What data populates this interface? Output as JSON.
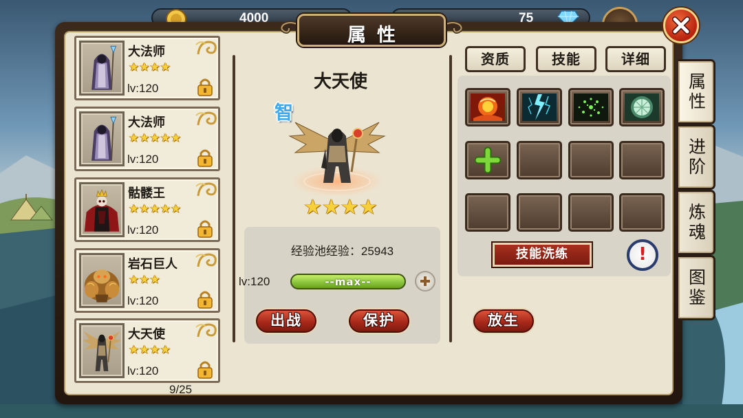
{
  "top_bar": {
    "gold": {
      "icon": "gold-coin-icon",
      "value": "4000"
    },
    "gems": {
      "icon": "diamond-icon",
      "value": "75"
    }
  },
  "window": {
    "title": "属性",
    "close_icon": "close-icon"
  },
  "hero_list": {
    "items": [
      {
        "name": "大法师",
        "stars": 4,
        "level": "lv:120",
        "portrait": "archmage-portrait",
        "lock_icon": "lock-icon"
      },
      {
        "name": "大法师",
        "stars": 5,
        "level": "lv:120",
        "portrait": "archmage-portrait",
        "lock_icon": "lock-icon"
      },
      {
        "name": "骷髅王",
        "stars": 5,
        "level": "lv:120",
        "portrait": "skeleton-king-portrait",
        "lock_icon": "lock-icon"
      },
      {
        "name": "岩石巨人",
        "stars": 3,
        "level": "lv:120",
        "portrait": "rock-giant-portrait",
        "lock_icon": "lock-icon"
      },
      {
        "name": "大天使",
        "stars": 4,
        "level": "lv:120",
        "portrait": "archangel-portrait",
        "lock_icon": "lock-icon"
      }
    ],
    "count": "9/25"
  },
  "hero_detail": {
    "name": "大天使",
    "attribute": "智",
    "stars": 4,
    "model": "archangel-figure",
    "exp_pool_label": "经验池经验：",
    "exp_pool_value": "25943",
    "level": "lv:120",
    "exp_bar_text": "--max--",
    "exp_progress": 1.0,
    "add_icon": "plus-circle-icon"
  },
  "skills": {
    "tabs": [
      {
        "label": "资质"
      },
      {
        "label": "技能"
      },
      {
        "label": "详细"
      }
    ],
    "slots": [
      "fire-skill-icon",
      "lightning-skill-icon",
      "green-sparkle-skill-icon",
      "teal-disc-skill-icon",
      "add-skill-icon",
      "empty",
      "empty",
      "empty",
      "empty",
      "empty",
      "empty",
      "empty"
    ],
    "refine_button": "技能洗练",
    "info_icon": "exclamation-icon"
  },
  "actions": {
    "deploy": "出战",
    "protect": "保护",
    "release": "放生"
  },
  "side_tabs": [
    {
      "label": "属性",
      "active": true
    },
    {
      "label": "进阶",
      "active": false
    },
    {
      "label": "炼魂",
      "active": false
    },
    {
      "label": "图鉴",
      "active": false
    }
  ],
  "colors": {
    "panel_frame": "#2e2117",
    "panel_bg": "#ebe4d1",
    "button_red": "#a8281a",
    "exp_bar_green": "#8cc63f",
    "attribute_blue": "#3ea8ee",
    "star_gold": "#f7d03c"
  }
}
